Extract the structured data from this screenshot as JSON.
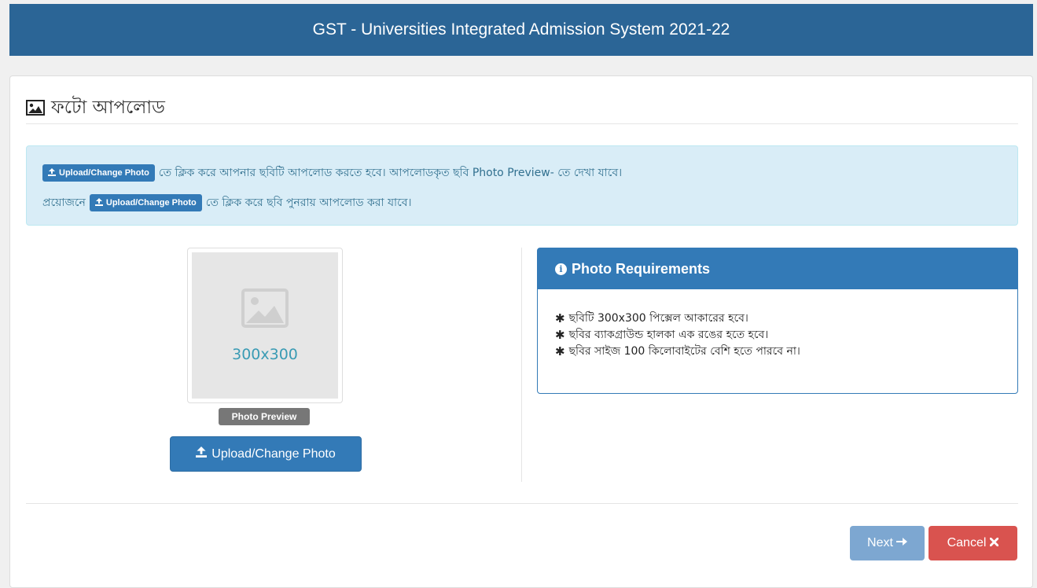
{
  "header": {
    "title": "GST - Universities Integrated Admission System 2021-22"
  },
  "page": {
    "heading": "ফটো আপলোড",
    "heading_icon": "image-icon"
  },
  "alert": {
    "button_label": "Upload/Change Photo",
    "line1_text": "তে ক্লিক করে আপনার ছবিটি আপলোড করতে হবে। আপলোডকৃত ছবি Photo Preview- তে দেখা যাবে।",
    "line2_prefix": "প্রয়োজনে",
    "line2_suffix": "তে ক্লিক করে ছবি পুনরায় আপলোড করা যাবে।"
  },
  "photo": {
    "placeholder_size": "300x300",
    "preview_label": "Photo Preview",
    "upload_button": "Upload/Change Photo"
  },
  "requirements": {
    "title": "Photo Requirements",
    "items": [
      "ছবিটি 300x300 পিক্সেল আকারের হবে।",
      "ছবির ব্যাকগ্রাউন্ড হালকা এক রঙের হতে হবে।",
      "ছবির সাইজ 100 কিলোবাইটের বেশি হতে পারবে না।"
    ]
  },
  "actions": {
    "next": "Next",
    "cancel": "Cancel"
  },
  "colors": {
    "header_bg": "#2b6596",
    "primary": "#337ab7",
    "danger": "#d9534f",
    "info_bg": "#d9edf7"
  }
}
